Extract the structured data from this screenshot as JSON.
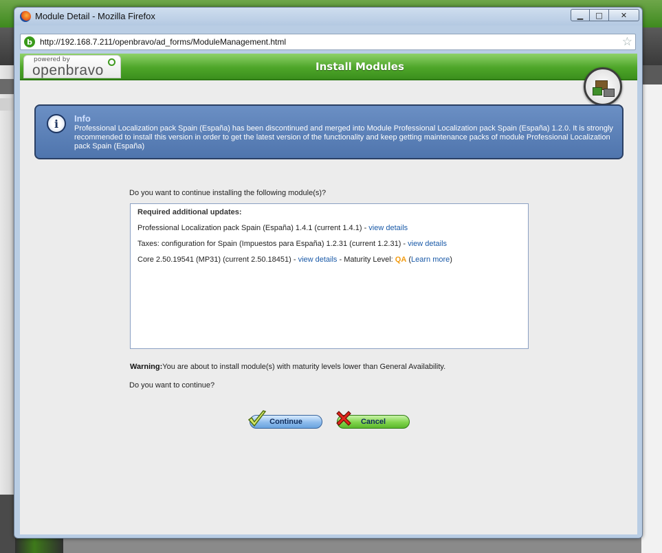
{
  "window": {
    "title": "Module Detail - Mozilla Firefox",
    "minimize": "▁",
    "maximize": "□",
    "close": "✕"
  },
  "browser": {
    "url": "http://192.168.7.211/openbravo/ad_forms/ModuleManagement.html"
  },
  "header": {
    "logo_powered": "powered by",
    "logo_brand": "openbravo",
    "title": "Install Modules"
  },
  "info": {
    "icon": "i",
    "title": "Info",
    "message": "Professional Localization pack Spain (España) has been discontinued and merged into Module Professional Localization pack Spain (España) 1.2.0. It is strongly recommended to install this version in order to get the latest version of the functionality and keep getting maintenance packs of module Professional Localization pack Spain (España)"
  },
  "main": {
    "question": "Do you want to continue installing the following module(s)?",
    "box_heading": "Required additional updates:",
    "modules": [
      {
        "text": "Professional Localization pack Spain (España) 1.4.1 (current 1.4.1) - ",
        "link": "view details"
      },
      {
        "text": "Taxes: configuration for Spain (Impuestos para España) 1.2.31 (current 1.2.31) - ",
        "link": "view details"
      },
      {
        "text": "Core 2.50.19541 (MP31) (current 2.50.18451) - ",
        "link": "view details",
        "maturity_prefix": " - Maturity Level: ",
        "maturity": "QA",
        "open_paren": " (",
        "learn_more": "Learn more",
        "close_paren": ")"
      }
    ],
    "warning_label": "Warning:",
    "warning_text": "You are about to install module(s) with maturity levels lower than General Availability.",
    "continue_question": "Do you want to continue?"
  },
  "buttons": {
    "continue": "Continue",
    "cancel": "Cancel"
  },
  "colors": {
    "header_green": "#4ea629",
    "info_blue": "#5a80b8",
    "link_blue": "#1a5aa8",
    "maturity_orange": "#f39c12"
  }
}
